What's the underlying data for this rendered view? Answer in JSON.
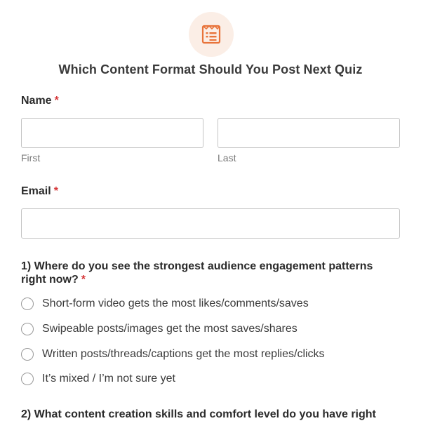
{
  "form": {
    "title": "Which Content Format Should You Post Next Quiz",
    "icon": "form-list-icon",
    "accent_color": "#e8733a",
    "badge_color": "#fbeee6",
    "required_color": "#d63638"
  },
  "name_field": {
    "label": "Name",
    "required_mark": "*",
    "first_sublabel": "First",
    "last_sublabel": "Last",
    "first_value": "",
    "last_value": ""
  },
  "email_field": {
    "label": "Email",
    "required_mark": "*",
    "value": ""
  },
  "questions": [
    {
      "text": "1) Where do you see the strongest audience engagement patterns right now?",
      "required_mark": "*",
      "options": [
        "Short-form video gets the most likes/comments/saves",
        "Swipeable posts/images get the most saves/shares",
        "Written posts/threads/captions get the most replies/clicks",
        "It’s mixed / I’m not sure yet"
      ]
    },
    {
      "text": "2) What content creation skills and comfort level do you have right"
    }
  ]
}
